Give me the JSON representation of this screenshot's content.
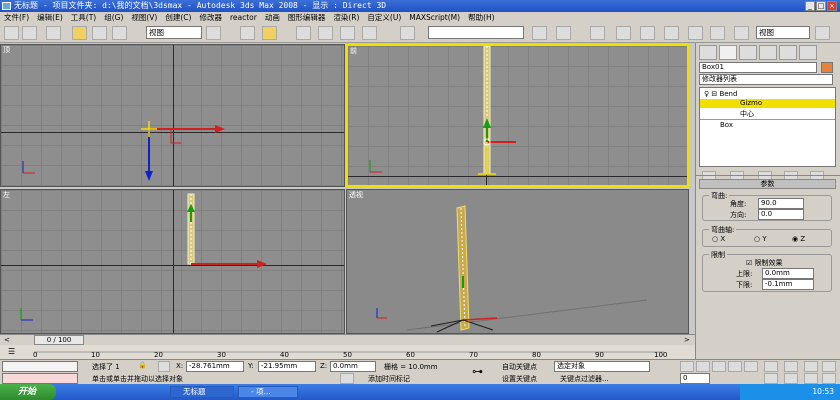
{
  "window": {
    "title": "无标题   - 项目文件夹: d:\\我的文档\\3dsmax   - Autodesk 3ds Max 2008   - 显示 : Direct 3D",
    "minimize": "_",
    "maximize": "□",
    "close": "×"
  },
  "menu": [
    "文件(F)",
    "编辑(E)",
    "工具(T)",
    "组(G)",
    "视图(V)",
    "创建(C)",
    "修改器",
    "reactor",
    "动画",
    "图形编辑器",
    "渲染(R)",
    "自定义(U)",
    "MAXScript(M)",
    "帮助(H)"
  ],
  "toolbar": {
    "filter": "全部",
    "coord": "视图",
    "named_sel": "",
    "view_sel": "视图"
  },
  "viewports": {
    "top": "顶",
    "front": "前",
    "left": "左",
    "persp": "透视"
  },
  "cmd": {
    "name": "Box01",
    "modifier_list": "修改器列表",
    "stack": {
      "bend": "Bend",
      "gizmo": "Gizmo",
      "center": "中心",
      "box": "Box"
    },
    "params_title": "参数",
    "bend_group": "弯曲:",
    "angle_label": "角度:",
    "angle_value": "90.0",
    "direction_label": "方向:",
    "direction_value": "0.0",
    "axis_group": "弯曲轴:",
    "axis_x": "X",
    "axis_y": "Y",
    "axis_z": "Z",
    "limit_group": "限制",
    "limit_effect": "限制效果",
    "upper_label": "上限:",
    "upper_value": "0.0mm",
    "lower_label": "下限:",
    "lower_value": "-0.1mm"
  },
  "timeline": {
    "frame": "0 / 100",
    "ticks": [
      "0",
      "10",
      "20",
      "30",
      "40",
      "50",
      "60",
      "70",
      "80",
      "90",
      "100"
    ]
  },
  "status": {
    "selected": "选择了 1",
    "x_label": "X:",
    "x_value": "-28.761mm",
    "y_label": "Y:",
    "y_value": "-21.95mm",
    "z_label": "Z:",
    "z_value": "0.0mm",
    "grid": "栅格 = 10.0mm",
    "prompt": "单击或单击并拖动以选择对象",
    "add_tag": "添加时间标记",
    "auto_key": "自动关键点",
    "set_key": "设置关键点",
    "sel_object": "选定对象",
    "key_filters": "关键点过滤器...",
    "frame_field": "0"
  },
  "taskbar": {
    "start": "开始",
    "task1": "无标题",
    "task2": "- 项...",
    "clock": "10:53"
  },
  "colors": {
    "titlebar": "#2152c4",
    "active_viewport": "#f0e000",
    "viewport_bg": "#8e8e8e",
    "highlight": "#f0e000"
  }
}
